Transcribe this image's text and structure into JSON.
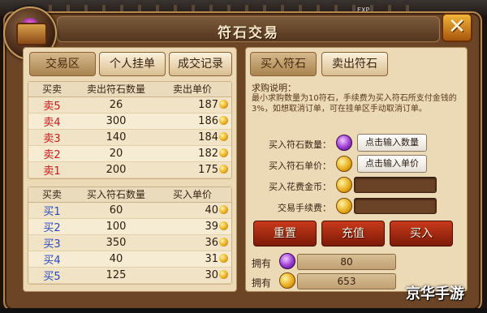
{
  "window": {
    "title": "符石交易",
    "close_label": "✕"
  },
  "hud": {
    "exp_label": "EXP"
  },
  "left_tabs": [
    "交易区",
    "个人挂单",
    "成交记录"
  ],
  "right_tabs": [
    "买入符石",
    "卖出符石"
  ],
  "sell_table": {
    "headers": [
      "买卖",
      "卖出符石数量",
      "卖出单价"
    ],
    "rows": [
      [
        "卖5",
        "26",
        "187"
      ],
      [
        "卖4",
        "300",
        "186"
      ],
      [
        "卖3",
        "140",
        "184"
      ],
      [
        "卖2",
        "20",
        "182"
      ],
      [
        "卖1",
        "200",
        "175"
      ]
    ]
  },
  "buy_table": {
    "headers": [
      "买卖",
      "买入符石数量",
      "买入单价"
    ],
    "rows": [
      [
        "买1",
        "60",
        "40"
      ],
      [
        "买2",
        "100",
        "39"
      ],
      [
        "买3",
        "350",
        "36"
      ],
      [
        "买4",
        "40",
        "31"
      ],
      [
        "买5",
        "125",
        "30"
      ]
    ]
  },
  "purchase": {
    "desc_title": "求购说明：",
    "desc_body": "最小求购数量为10符石，手续费为买入符石所支付金钱的3%，如想取消订单，可在挂单区手动取消订单。",
    "qty_label": "买入符石数量：",
    "qty_button": "点击输入数量",
    "price_label": "买入符石单价：",
    "price_button": "点击输入单价",
    "cost_label": "买入花费金币：",
    "fee_label": "交易手续费：",
    "buttons": [
      "重置",
      "充值",
      "买入"
    ]
  },
  "owned": {
    "label": "拥有",
    "stone": "80",
    "gold": "653"
  },
  "watermark": "京华手游",
  "colors": {
    "sell": "#c81a1a",
    "buy": "#2a49c0",
    "action": "#a8300e"
  }
}
